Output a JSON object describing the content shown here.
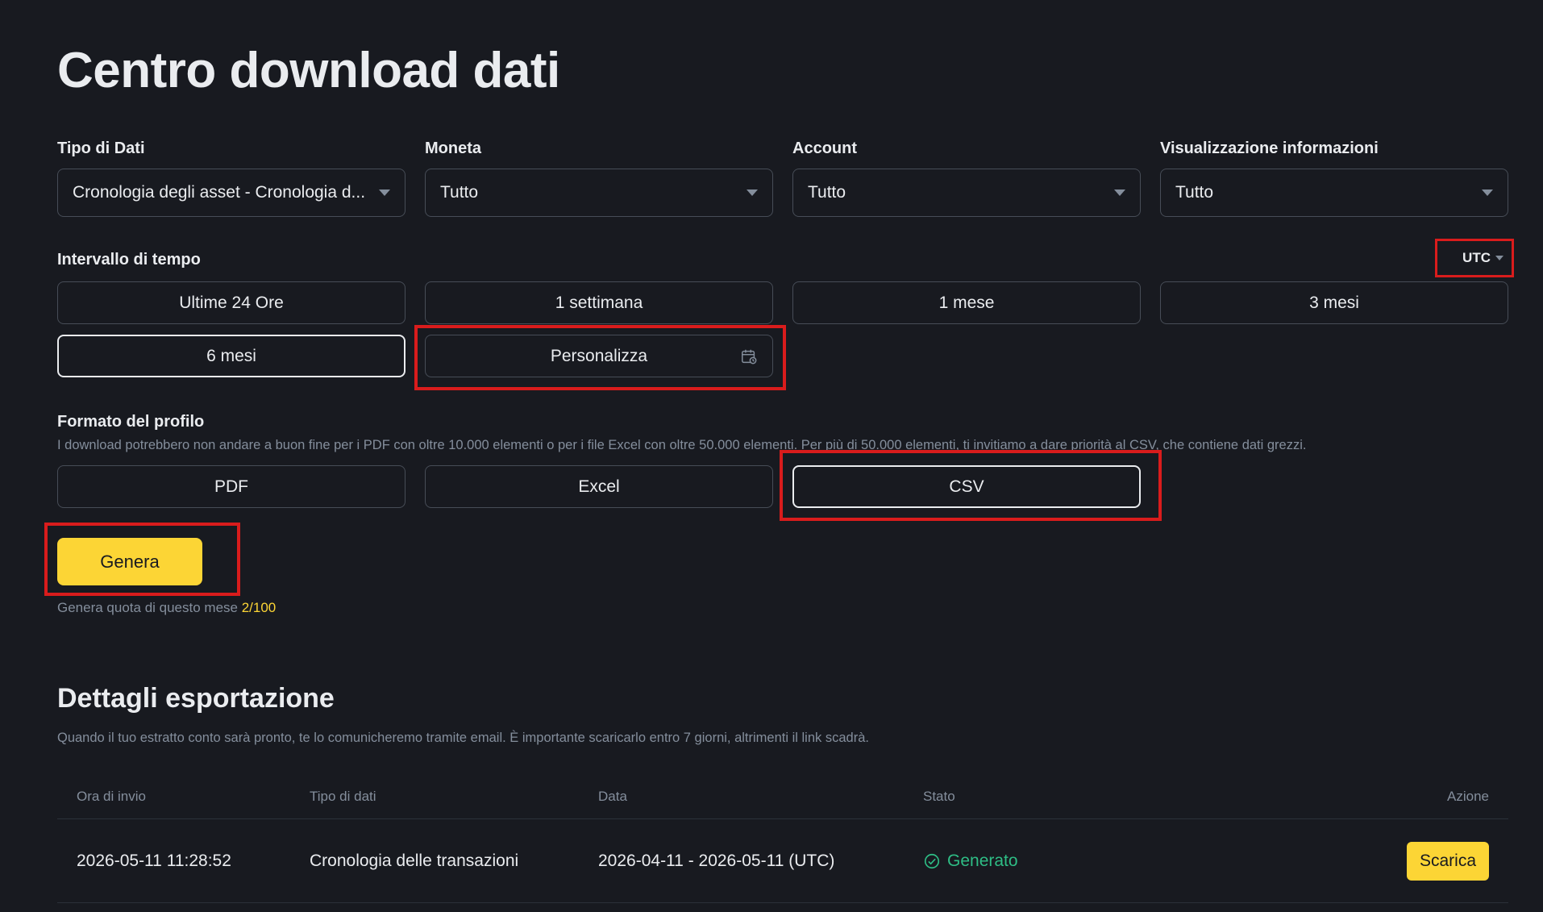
{
  "page": {
    "title": "Centro download dati"
  },
  "filters": [
    {
      "label": "Tipo di Dati",
      "value": "Cronologia degli asset - Cronologia d..."
    },
    {
      "label": "Moneta",
      "value": "Tutto"
    },
    {
      "label": "Account",
      "value": "Tutto"
    },
    {
      "label": "Visualizzazione informazioni",
      "value": "Tutto"
    }
  ],
  "time_range": {
    "label": "Intervallo di tempo",
    "timezone": "UTC",
    "options": [
      "Ultime 24 Ore",
      "1 settimana",
      "1 mese",
      "3 mesi",
      "6 mesi",
      "Personalizza"
    ],
    "selected": "6 mesi"
  },
  "format": {
    "label": "Formato del profilo",
    "hint": "I download potrebbero non andare a buon fine per i PDF con oltre 10.000 elementi o per i file Excel con oltre 50.000 elementi. Per più di 50.000 elementi, ti invitiamo a dare priorità al CSV, che contiene dati grezzi.",
    "options": [
      "PDF",
      "Excel",
      "CSV"
    ],
    "selected": "CSV"
  },
  "generate": {
    "button_label": "Genera",
    "quota_label": "Genera quota di questo mese",
    "quota_value": "2/100"
  },
  "export": {
    "title": "Dettagli esportazione",
    "hint": "Quando il tuo estratto conto sarà pronto, te lo comunicheremo tramite email. È importante scaricarlo entro 7 giorni, altrimenti il link scadrà.",
    "columns": [
      "Ora di invio",
      "Tipo di dati",
      "Data",
      "Stato",
      "Azione"
    ],
    "rows": [
      {
        "sent": "2026-05-11 11:28:52",
        "type": "Cronologia delle transazioni",
        "date": "2026-04-11 - 2026-05-11 (UTC)",
        "status": "Generato",
        "action": "Scarica"
      }
    ]
  },
  "colors": {
    "background": "#181a20",
    "accent": "#fcd535",
    "success": "#2ebd85",
    "highlight": "#d91c1c"
  }
}
